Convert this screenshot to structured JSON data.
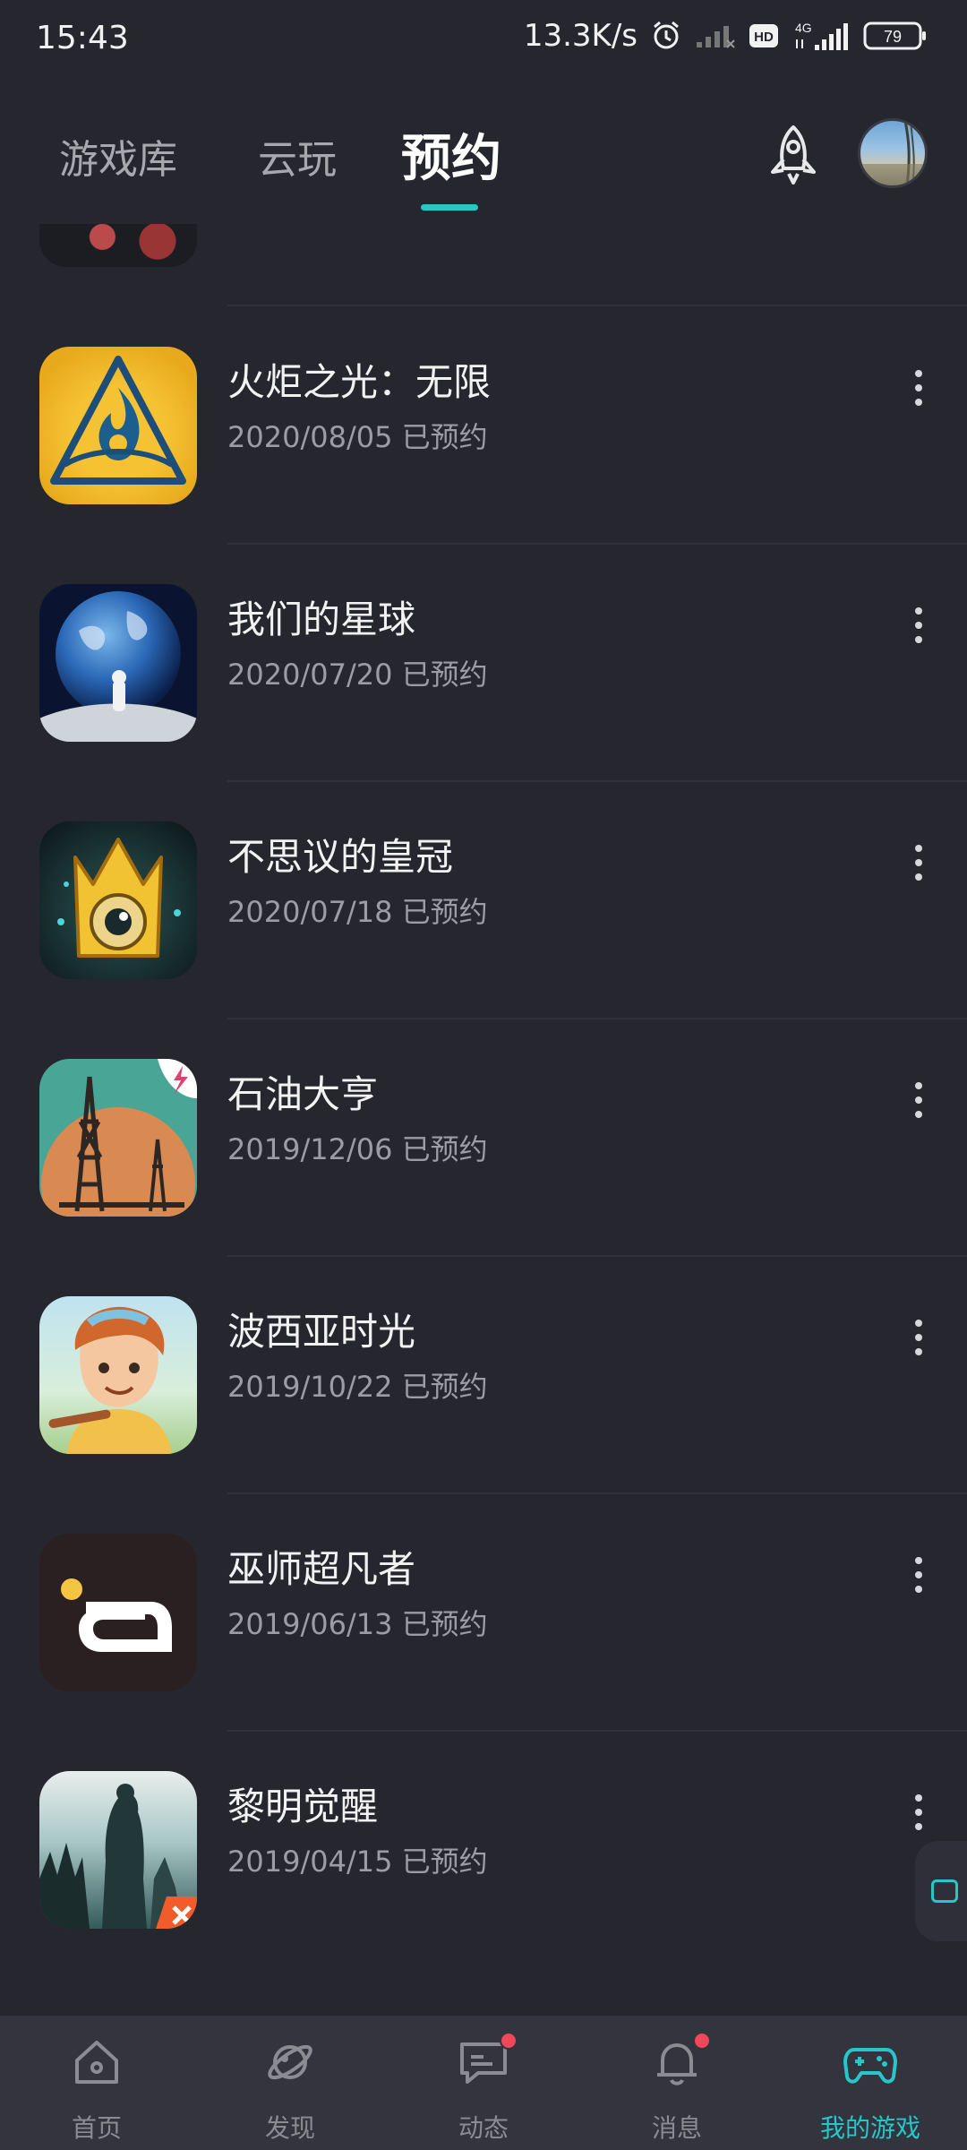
{
  "status_bar": {
    "time": "15:43",
    "net_speed": "13.3K/s",
    "network": "4G",
    "hd": "HD",
    "battery": "79"
  },
  "header": {
    "tabs": [
      {
        "label": "游戏库",
        "active": false
      },
      {
        "label": "云玩",
        "active": false
      },
      {
        "label": "预约",
        "active": true
      }
    ]
  },
  "games": [
    {
      "title": "火炬之光：无限",
      "date": "2020/08/05",
      "status": "已预约",
      "icon": "torchlight-icon"
    },
    {
      "title": "我们的星球",
      "date": "2020/07/20",
      "status": "已预约",
      "icon": "planet-icon"
    },
    {
      "title": "不思议的皇冠",
      "date": "2020/07/18",
      "status": "已预约",
      "icon": "crown-icon"
    },
    {
      "title": "石油大亨",
      "date": "2019/12/06",
      "status": "已预约",
      "icon": "oil-rig-icon"
    },
    {
      "title": "波西亚时光",
      "date": "2019/10/22",
      "status": "已预约",
      "icon": "portia-icon"
    },
    {
      "title": "巫师超凡者",
      "date": "2019/06/13",
      "status": "已预约",
      "icon": "wizard-icon"
    },
    {
      "title": "黎明觉醒",
      "date": "2019/04/15",
      "status": "已预约",
      "icon": "dawn-icon"
    }
  ],
  "bottom_nav": [
    {
      "label": "首页",
      "icon": "home-icon",
      "active": false,
      "badge": false
    },
    {
      "label": "发现",
      "icon": "planet-orbit-icon",
      "active": false,
      "badge": false
    },
    {
      "label": "动态",
      "icon": "chat-icon",
      "active": false,
      "badge": true
    },
    {
      "label": "消息",
      "icon": "bell-icon",
      "active": false,
      "badge": true
    },
    {
      "label": "我的游戏",
      "icon": "gamepad-icon",
      "active": true,
      "badge": false
    }
  ],
  "colors": {
    "background": "#25262e",
    "accent": "#26c6c9",
    "badge": "#f0475a"
  }
}
